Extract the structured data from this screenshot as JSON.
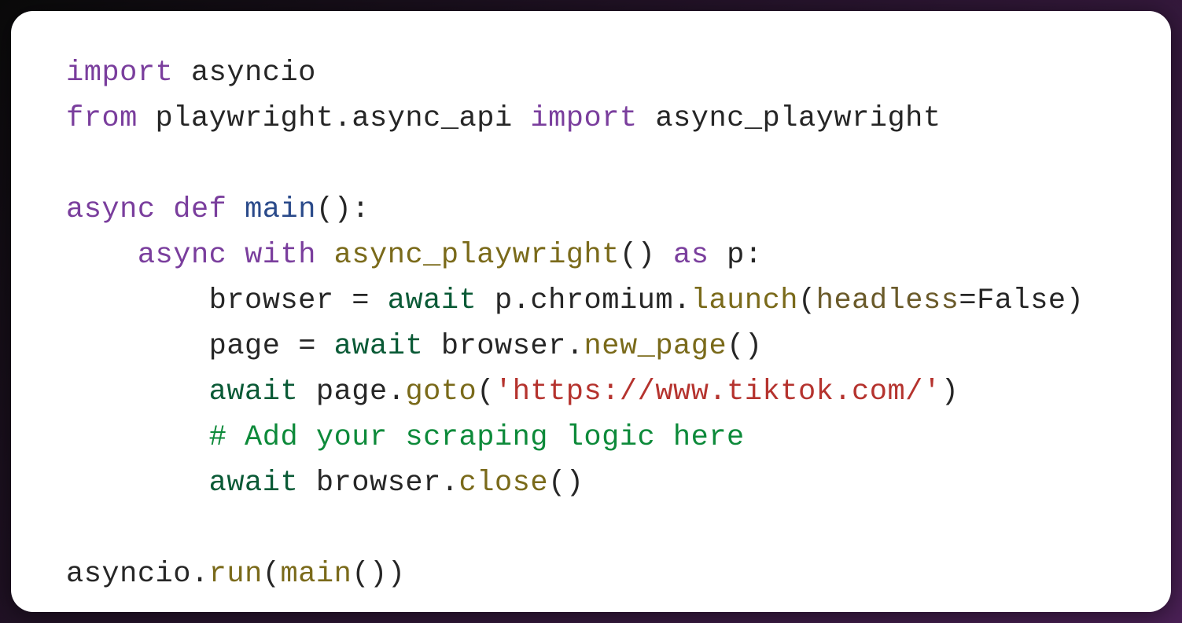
{
  "code": {
    "line1": {
      "kw_import": "import",
      "mod_asyncio": "asyncio"
    },
    "line2": {
      "kw_from": "from",
      "mod_playwright": "playwright",
      "attr_async_api": "async_api",
      "kw_import": "import",
      "name_async_playwright": "async_playwright"
    },
    "line4": {
      "kw_async": "async",
      "kw_def": "def",
      "func_main": "main"
    },
    "line5": {
      "kw_async": "async",
      "kw_with": "with",
      "call_async_playwright": "async_playwright",
      "kw_as": "as",
      "var_p": "p"
    },
    "line6": {
      "var_browser": "browser",
      "kw_await": "await",
      "var_p": "p",
      "attr_chromium": "chromium",
      "method_launch": "launch",
      "param_headless": "headless",
      "val_false": "False"
    },
    "line7": {
      "var_page": "page",
      "kw_await": "await",
      "var_browser": "browser",
      "method_new_page": "new_page"
    },
    "line8": {
      "kw_await": "await",
      "var_page": "page",
      "method_goto": "goto",
      "str_url": "'https://www.tiktok.com/'"
    },
    "line9": {
      "comment": "# Add your scraping logic here"
    },
    "line10": {
      "kw_await": "await",
      "var_browser": "browser",
      "method_close": "close"
    },
    "line12": {
      "mod_asyncio": "asyncio",
      "method_run": "run",
      "func_main": "main"
    }
  }
}
